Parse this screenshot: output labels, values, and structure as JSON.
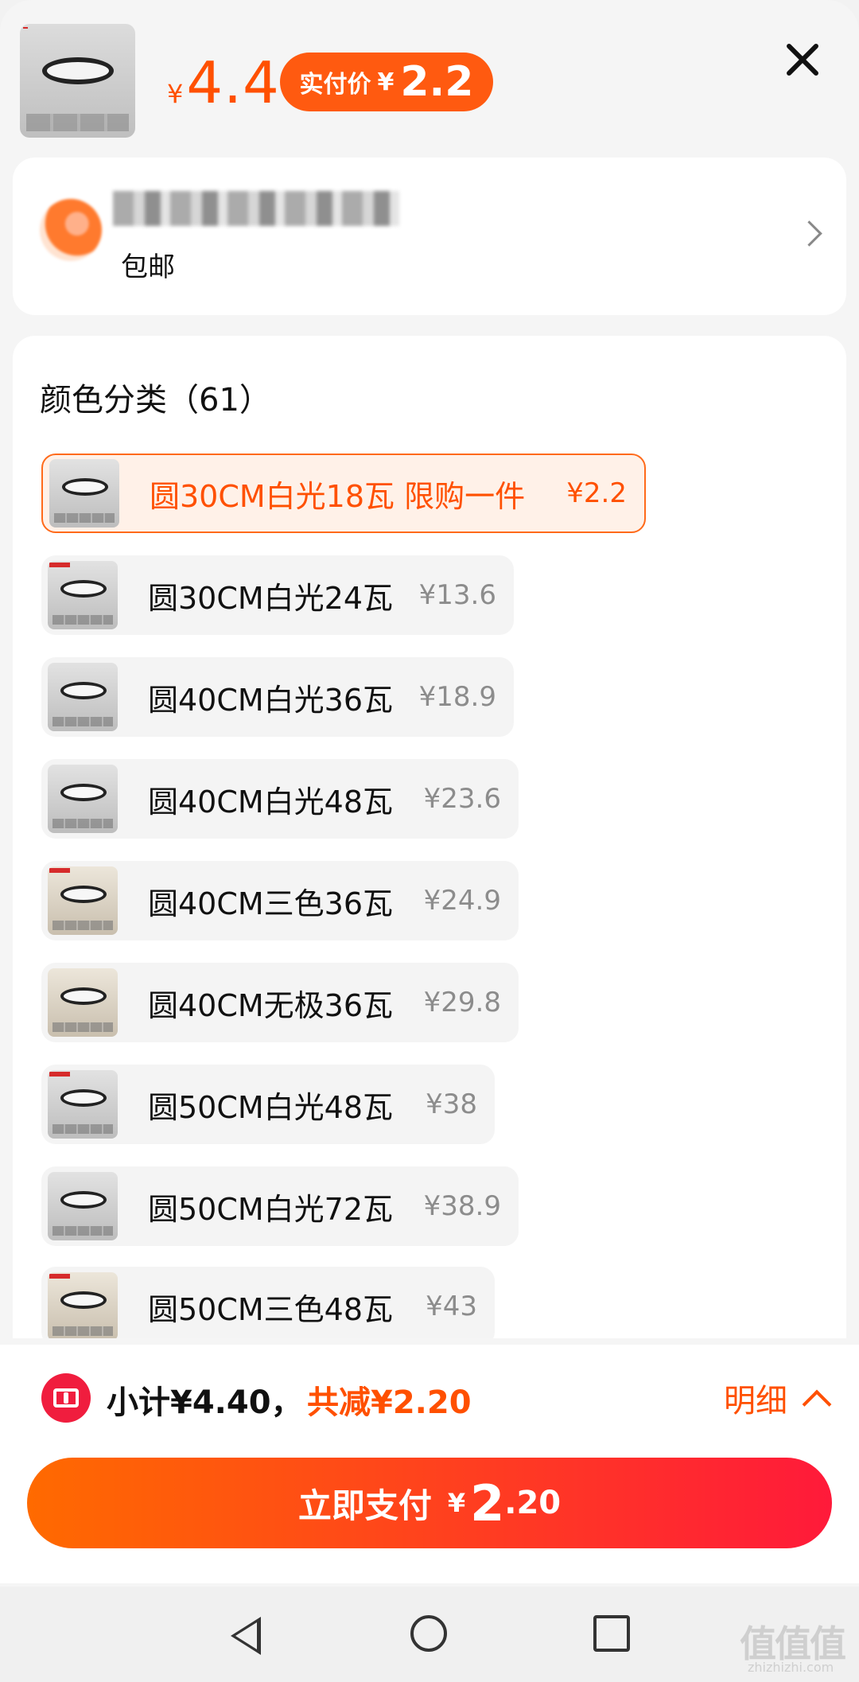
{
  "header": {
    "price_yen": "¥",
    "price_value": "4.4",
    "pay_label": "实付价",
    "pay_yen": "¥",
    "pay_value": "2.2"
  },
  "shop": {
    "subtitle": "包邮"
  },
  "variants": {
    "title": "颜色分类（61）",
    "items": [
      {
        "name": "圆30CM白光18瓦 限购一件",
        "price": "¥2.2",
        "selected": true
      },
      {
        "name": "圆30CM白光24瓦",
        "price": "¥13.6"
      },
      {
        "name": "圆40CM白光36瓦",
        "price": "¥18.9"
      },
      {
        "name": "圆40CM白光48瓦",
        "price": "¥23.6"
      },
      {
        "name": "圆40CM三色36瓦",
        "price": "¥24.9"
      },
      {
        "name": "圆40CM无极36瓦",
        "price": "¥29.8"
      },
      {
        "name": "圆50CM白光48瓦",
        "price": "¥38"
      },
      {
        "name": "圆50CM白光72瓦",
        "price": "¥38.9"
      },
      {
        "name": "圆50CM三色48瓦",
        "price": "¥43"
      }
    ]
  },
  "summary": {
    "subtotal": "小计¥4.40，",
    "saved": "共减¥2.20",
    "detail": "明细"
  },
  "pay_button": {
    "label": "立即支付",
    "yen": "¥",
    "int": "2",
    "dec": ".20"
  },
  "watermark": {
    "text": "值值值",
    "sub": "zhizhizhi.com"
  },
  "colors": {
    "accent": "#ff5000",
    "pay_gradient_start": "#ff6a00",
    "pay_gradient_end": "#ff1a3a",
    "coupon_red": "#f01d3e"
  }
}
